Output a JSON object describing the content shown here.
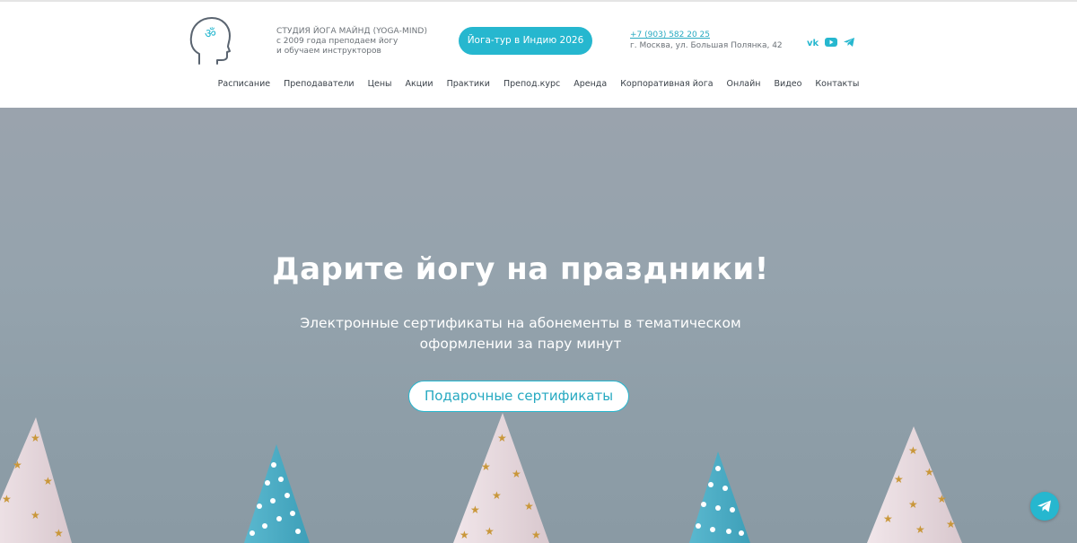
{
  "header": {
    "brand_title": "СТУДИЯ ЙОГА МАЙНД (YOGA-MIND)",
    "brand_line2": "с 2009 года преподаем йогу",
    "brand_line3": "и обучаем инструкторов",
    "tour_button": "Йога-тур в Индию 2026",
    "phone": "+7 (903) 582 20 25",
    "address": "г. Москва, ул. Большая Полянка, 42",
    "socials": [
      "vk-icon",
      "youtube-icon",
      "telegram-icon"
    ]
  },
  "nav": {
    "items": [
      "Расписание",
      "Преподаватели",
      "Цены",
      "Акции",
      "Практики",
      "Препод.курс",
      "Аренда",
      "Корпоративная йога",
      "Онлайн",
      "Видео",
      "Контакты"
    ]
  },
  "hero": {
    "title": "Дарите йогу на праздники!",
    "subtitle_line1": "Электронные сертификаты на абонементы в тематическом",
    "subtitle_line2": "оформлении за пару минут",
    "button": "Подарочные сертификаты"
  },
  "colors": {
    "accent": "#26b7cf",
    "text_dark": "#3a4149",
    "text_muted": "#6b7177",
    "hero_bg": "#95a3ad"
  },
  "floating": {
    "icon": "telegram-icon"
  }
}
